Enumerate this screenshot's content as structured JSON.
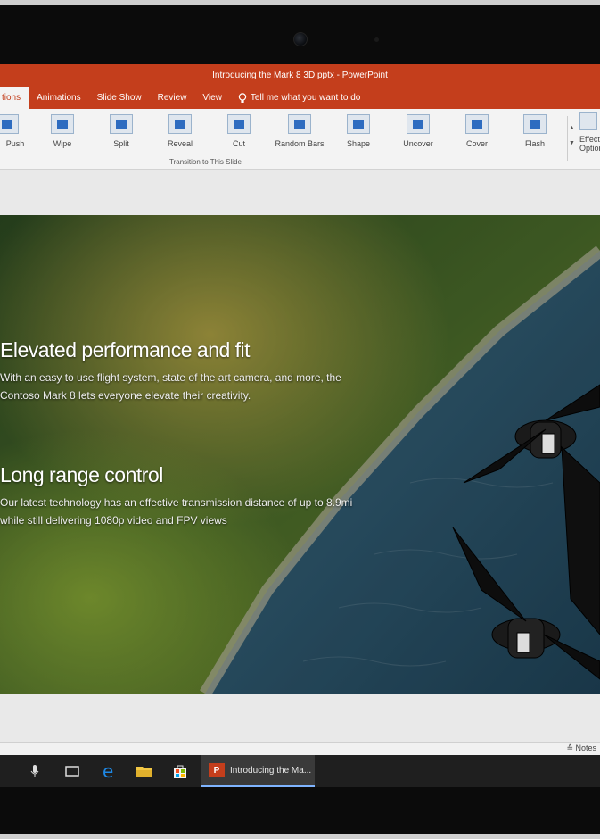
{
  "window": {
    "title": "Introducing the Mark 8 3D.pptx  -  PowerPoint"
  },
  "tabs": [
    {
      "label": "tions",
      "active": true
    },
    {
      "label": "Animations"
    },
    {
      "label": "Slide Show"
    },
    {
      "label": "Review"
    },
    {
      "label": "View"
    }
  ],
  "tell_me": "Tell me what you want to do",
  "ribbon": {
    "transitions": [
      "Push",
      "Wipe",
      "Split",
      "Reveal",
      "Cut",
      "Random Bars",
      "Shape",
      "Uncover",
      "Cover",
      "Flash"
    ],
    "group_label": "Transition to This Slide",
    "effect_options": "Effect Options"
  },
  "slide": {
    "heading1": "Elevated performance and fit",
    "body1": "With an easy to use flight system, state of the art camera, and more, the Contoso Mark 8 lets everyone elevate their creativity.",
    "heading2": "Long range control",
    "body2": "Our latest technology has an effective transmission distance of up to 8.9mi while still delivering 1080p video and FPV views"
  },
  "status": {
    "notes": "Notes"
  },
  "taskbar": {
    "active_app": "Introducing the Ma..."
  },
  "colors": {
    "accent": "#c43e1c",
    "taskbar": "#1f1f1f"
  }
}
